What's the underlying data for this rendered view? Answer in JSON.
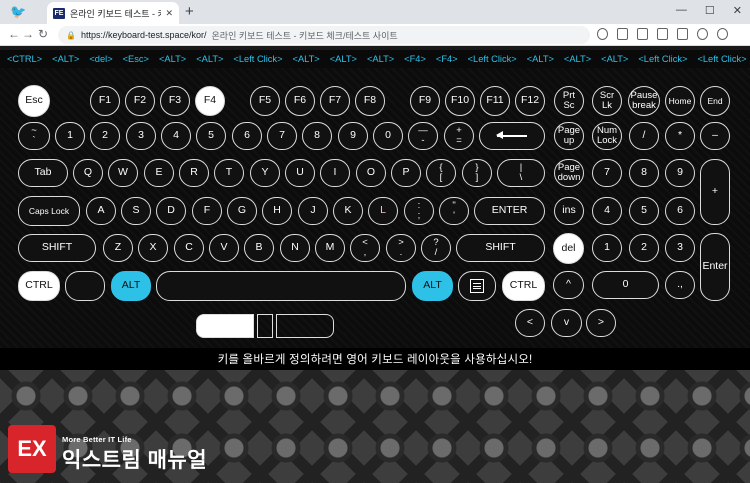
{
  "browser": {
    "tab_logo": "FE",
    "tab_title": "온라인 키보드 테스트 - 키보드",
    "tab_close": "✕",
    "new_tab": "+",
    "win_minimize": "—",
    "win_maximize": "☐",
    "win_close": "✕",
    "nav_back": "←",
    "nav_forward": "→",
    "nav_reload": "↻",
    "url": "https://keyboard-test.space/kor/",
    "page_title": "온라인 키보드 테스트 - 키보드 체크/테스트 사이트"
  },
  "key_log": [
    "<CTRL>",
    "<ALT>",
    "<del>",
    "<Esc>",
    "<ALT>",
    "<ALT>",
    "<Left Click>",
    "<ALT>",
    "<ALT>",
    "<ALT>",
    "<F4>",
    "<F4>",
    "<Left Click>",
    "<ALT>",
    "<ALT>",
    "<ALT>",
    "<Left Click>",
    "<Left Click>"
  ],
  "keys": {
    "esc": "Esc",
    "f1": "F1",
    "f2": "F2",
    "f3": "F3",
    "f4": "F4",
    "f5": "F5",
    "f6": "F6",
    "f7": "F7",
    "f8": "F8",
    "f9": "F9",
    "f10": "F10",
    "f11": "F11",
    "f12": "F12",
    "prtsc_top": "Prt",
    "prtsc_bot": "Sc",
    "scrlk_top": "Scr",
    "scrlk_bot": "Lk",
    "pause_top": "Pause",
    "pause_bot": "break",
    "home": "Home",
    "end": "End",
    "tilde_top": "~",
    "tilde_bot": "`",
    "n1": "1",
    "n2": "2",
    "n3": "3",
    "n4": "4",
    "n5": "5",
    "n6": "6",
    "n7": "7",
    "n8": "8",
    "n9": "9",
    "n0": "0",
    "minus_top": "—",
    "minus_bot": "-",
    "plus_top": "+",
    "plus_bot": "=",
    "pgup_top": "Page",
    "pgup_bot": "up",
    "numlock_top": "Num",
    "numlock_bot": "Lock",
    "np_div": "/",
    "np_mul": "*",
    "np_sub": "–",
    "tab": "Tab",
    "q": "Q",
    "w": "W",
    "e": "E",
    "r": "R",
    "t": "T",
    "y": "Y",
    "u": "U",
    "i": "I",
    "o": "O",
    "p": "P",
    "lbrace_top": "{",
    "lbrace_bot": "[",
    "rbrace_top": "}",
    "rbrace_bot": "]",
    "pipe_top": "|",
    "pipe_bot": "\\",
    "pgdn_top": "Page",
    "pgdn_bot": "down",
    "np7": "7",
    "np8": "8",
    "np9": "9",
    "np_add": "+",
    "caps": "Caps Lock",
    "a": "A",
    "s": "S",
    "d": "D",
    "f": "F",
    "g": "G",
    "h": "H",
    "j": "J",
    "k": "K",
    "l": "L",
    "semi_top": ":",
    "semi_bot": ";",
    "quote_top": "\"",
    "quote_bot": "'",
    "enter": "ENTER",
    "ins": "ins",
    "np4": "4",
    "np5": "5",
    "np6": "6",
    "lshift": "SHIFT",
    "z": "Z",
    "x": "X",
    "c": "C",
    "v": "V",
    "b": "B",
    "n": "N",
    "m": "M",
    "lt_top": "<",
    "lt_bot": ",",
    "gt_top": ">",
    "gt_bot": ".",
    "q_top": "?",
    "q_bot": "/",
    "rshift": "SHIFT",
    "del": "del",
    "np1": "1",
    "np2": "2",
    "np3": "3",
    "np_enter": "Enter",
    "lctrl": "CTRL",
    "lalt": "ALT",
    "ralt": "ALT",
    "rctrl": "CTRL",
    "up": "^",
    "left": "<",
    "down": "v",
    "right": ">",
    "np0": "0",
    "np_dot": "., "
  },
  "notice": "키를 올바르게 정의하려면 영어 키보드 레이아웃을 사용하십시오!",
  "watermark": {
    "mark": "EX",
    "sub": "More Better IT Life",
    "main": "익스트림 매뉴얼"
  }
}
